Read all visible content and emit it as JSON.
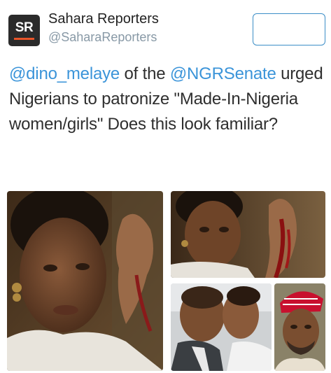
{
  "account": {
    "display_name": "Sahara Reporters",
    "handle": "@SaharaReporters",
    "avatar_text": "SR"
  },
  "follow_button": {
    "label": ""
  },
  "tweet": {
    "mention1": "@dino_melaye",
    "text1": " of the ",
    "mention2": "@NGRSenate",
    "text2": " urged Nigerians to patronize \"Made-In-Nigeria women/girls\" Does this look familiar?"
  },
  "media": {
    "count": 4
  },
  "colors": {
    "link": "#3b94d9",
    "follow_border": "#3c8ec7",
    "muted": "#8899a6",
    "text": "#2f2f2f",
    "avatar_bg": "#2b2b2b",
    "avatar_accent": "#e8552a"
  }
}
